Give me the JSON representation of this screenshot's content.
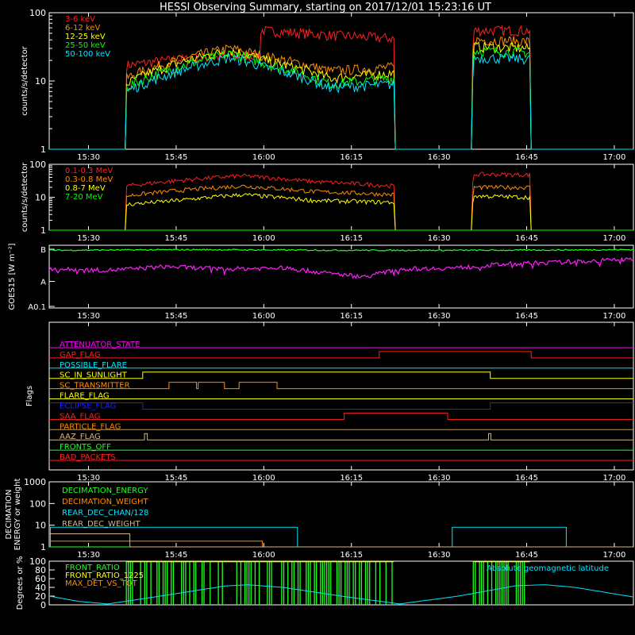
{
  "title": "HESSI Observing Summary, starting on 2017/12/01 15:23:16 UT",
  "time_ticks": [
    "15:30",
    "15:45",
    "16:00",
    "16:15",
    "16:30",
    "16:45",
    "17:00"
  ],
  "time_tick_minutes": [
    6.73,
    21.73,
    36.73,
    51.73,
    66.73,
    81.73,
    96.73
  ],
  "chart_data": [
    {
      "type": "line",
      "panel": "lightcurves-low",
      "ylabel": "counts/s/detector",
      "yscale": "log",
      "ylim": [
        1,
        100
      ],
      "yticks": [
        "1",
        "10",
        "100"
      ],
      "x_unit": "minutes after 15:23:16 UT",
      "xlim": [
        0,
        100
      ],
      "series": [
        {
          "name": "3-6 keV",
          "color": "#ff2020",
          "x": [
            0,
            13,
            13.2,
            20,
            36,
            36.3,
            48,
            59,
            59.1,
            72.4,
            72.6,
            82.3,
            82.4,
            100
          ],
          "y": [
            1,
            1,
            17,
            20,
            24,
            55,
            47,
            42,
            1,
            1,
            55,
            55,
            1,
            1
          ]
        },
        {
          "name": "6-12 keV",
          "color": "#ff8c00",
          "x": [
            0,
            13,
            13.2,
            20,
            31,
            38,
            48,
            59,
            59.1,
            72.4,
            72.6,
            82.3,
            82.4,
            100
          ],
          "y": [
            1,
            1,
            11,
            18,
            30,
            22,
            14,
            16,
            1,
            1,
            40,
            38,
            1,
            1
          ]
        },
        {
          "name": "12-25 keV",
          "color": "#ffff00",
          "x": [
            0,
            13,
            13.2,
            20,
            31,
            38,
            48,
            59,
            59.1,
            72.4,
            72.6,
            82.3,
            82.4,
            100
          ],
          "y": [
            1,
            1,
            9,
            16,
            28,
            19,
            11,
            13,
            1,
            1,
            32,
            30,
            1,
            1
          ]
        },
        {
          "name": "25-50 keV",
          "color": "#00ff00",
          "x": [
            0,
            13,
            13.2,
            20,
            31,
            38,
            48,
            59,
            59.1,
            72.4,
            72.6,
            82.3,
            82.4,
            100
          ],
          "y": [
            1,
            1,
            8,
            14,
            25,
            17,
            9,
            11,
            1,
            1,
            28,
            26,
            1,
            1
          ]
        },
        {
          "name": "50-100 keV",
          "color": "#00e5ff",
          "x": [
            0,
            13,
            13.2,
            20,
            31,
            38,
            48,
            59,
            59.1,
            72.4,
            72.6,
            82.3,
            82.4,
            100
          ],
          "y": [
            1,
            1,
            7,
            12,
            22,
            15,
            8,
            9,
            1,
            1,
            22,
            21,
            1,
            1
          ]
        }
      ]
    },
    {
      "type": "line",
      "panel": "lightcurves-high",
      "ylabel": "counts/s/detector",
      "yscale": "log",
      "ylim": [
        1,
        100
      ],
      "yticks": [
        "1",
        "10",
        "100"
      ],
      "x_unit": "minutes after 15:23:16 UT",
      "xlim": [
        0,
        100
      ],
      "series": [
        {
          "name": "0.1-0.3 MeV",
          "color": "#ff2020",
          "x": [
            0,
            13,
            13.2,
            22,
            33,
            45,
            59,
            59.1,
            72.4,
            72.6,
            82.3,
            82.4,
            100
          ],
          "y": [
            1,
            1,
            22,
            32,
            45,
            30,
            22,
            1,
            1,
            50,
            48,
            1,
            1
          ]
        },
        {
          "name": "0.3-0.8 MeV",
          "color": "#ff8c00",
          "x": [
            0,
            13,
            13.2,
            22,
            33,
            45,
            59,
            59.1,
            72.4,
            72.6,
            82.3,
            82.4,
            100
          ],
          "y": [
            1,
            1,
            11,
            16,
            22,
            15,
            12,
            1,
            1,
            20,
            20,
            1,
            1
          ]
        },
        {
          "name": "0.8-7 MeV",
          "color": "#ffff00",
          "x": [
            0,
            13,
            13.2,
            22,
            33,
            45,
            59,
            59.1,
            72.4,
            72.6,
            82.3,
            82.4,
            100
          ],
          "y": [
            1,
            1,
            6,
            8,
            12,
            8,
            7,
            1,
            1,
            11,
            10,
            1,
            1
          ]
        },
        {
          "name": "7-20 MeV",
          "color": "#00ff00",
          "x": [
            0,
            100
          ],
          "y": [
            1,
            1
          ]
        }
      ]
    },
    {
      "type": "line",
      "panel": "goes",
      "ylabel": "GOES15 [W m⁻²]",
      "yscale": "log",
      "ylim": [
        0.05,
        1.4
      ],
      "yticks": [
        "A0.1",
        "A",
        "B"
      ],
      "ytick_values": [
        0.1,
        1,
        10
      ],
      "x_unit": "minutes after 15:23:16 UT",
      "xlim": [
        0,
        100
      ],
      "series": [
        {
          "color": "#20ff20",
          "x": [
            0,
            25,
            50,
            75,
            100
          ],
          "y": [
            0.92,
            0.93,
            0.92,
            0.92,
            0.93
          ]
        },
        {
          "color": "#ff20ff",
          "x": [
            0,
            10,
            20,
            30,
            40,
            48,
            54,
            60,
            70,
            78,
            88,
            95,
            100
          ],
          "y": [
            0.62,
            0.6,
            0.66,
            0.62,
            0.64,
            0.55,
            0.5,
            0.62,
            0.64,
            0.7,
            0.73,
            0.76,
            0.78
          ]
        }
      ]
    },
    {
      "type": "line",
      "panel": "flags",
      "ylabel": "Flags",
      "xlim": [
        0,
        100
      ],
      "series": [
        {
          "name": "ATTENUATOR_STATE",
          "color": "#ff00ff",
          "x": [
            0,
            100
          ],
          "y": [
            0,
            0
          ]
        },
        {
          "name": "GAP_FLAG",
          "color": "#ff2020",
          "x": [
            0,
            56.5,
            56.5,
            82.5,
            82.5,
            100
          ],
          "y": [
            0,
            0,
            1,
            1,
            0,
            0
          ]
        },
        {
          "name": "POSSIBLE_FLARE",
          "color": "#00e5ff",
          "x": [
            0,
            100
          ],
          "y": [
            0,
            0
          ]
        },
        {
          "name": "SC_IN_SUNLIGHT",
          "color": "#ffff00",
          "x": [
            0,
            16,
            16,
            75.5,
            75.5,
            100
          ],
          "y": [
            0,
            0,
            1,
            1,
            0,
            0
          ]
        },
        {
          "name": "SC_TRANSMITTER",
          "color": "#ff8c00",
          "x": [
            0,
            20.5,
            20.5,
            25.2,
            25.2,
            25.5,
            25.5,
            30,
            30,
            32.5,
            32.5,
            39,
            39,
            100
          ],
          "y": [
            0,
            0,
            1,
            1,
            0,
            0,
            1,
            1,
            0,
            0,
            1,
            1,
            0,
            0
          ]
        },
        {
          "name": "FLARE_FLAG",
          "color": "#ffff00",
          "x": [
            0,
            100
          ],
          "y": [
            0,
            0
          ]
        },
        {
          "name": "ECLIPSE_FLAG",
          "color": "#2020ff",
          "x": [
            0,
            16,
            16,
            75.5,
            75.5,
            100
          ],
          "y": [
            1,
            1,
            0,
            0,
            1,
            1
          ]
        },
        {
          "name": "SAA_FLAG",
          "color": "#ff2020",
          "x": [
            0,
            50.5,
            50.5,
            68.2,
            68.2,
            100
          ],
          "y": [
            0,
            0,
            1,
            1,
            0,
            0
          ]
        },
        {
          "name": "PARTICLE_FLAG",
          "color": "#ff8c00",
          "x": [
            0,
            100
          ],
          "y": [
            0,
            0
          ]
        },
        {
          "name": "AAZ_FLAG",
          "color": "#d2b48c",
          "x": [
            0,
            16.3,
            16.3,
            16.8,
            16.8,
            75.2,
            75.2,
            75.6,
            75.6,
            100
          ],
          "y": [
            0,
            0,
            1,
            1,
            0,
            0,
            1,
            1,
            0,
            0
          ]
        },
        {
          "name": "FRONTS_OFF",
          "color": "#20ff20",
          "x": [
            0,
            100
          ],
          "y": [
            0,
            0
          ]
        },
        {
          "name": "BAD_PACKETS",
          "color": "#ff2020",
          "x": [
            0,
            100
          ],
          "y": [
            0,
            0
          ]
        }
      ]
    },
    {
      "type": "line",
      "panel": "decimation",
      "ylabel": "DECIMATION ENERGY or weight",
      "yscale": "log",
      "ylim": [
        1,
        1000
      ],
      "yticks": [
        "1",
        "10",
        "100",
        "1000"
      ],
      "xlim": [
        0,
        100
      ],
      "series": [
        {
          "name": "DECIMATION_ENERGY",
          "color": "#20ff20",
          "x": [
            0,
            100
          ],
          "y": [
            1,
            1
          ]
        },
        {
          "name": "DECIMATION_WEIGHT",
          "color": "#ff8c00",
          "x": [
            0,
            36.5,
            36.5,
            100
          ],
          "y": [
            1.85,
            1.85,
            1,
            1
          ]
        },
        {
          "name": "REAR_DEC_CHAN/128",
          "color": "#00e5ff",
          "x": [
            0,
            0.2,
            0.2,
            42.5,
            42.5,
            69,
            69,
            88.5,
            88.5,
            100
          ],
          "y": [
            1,
            1,
            8,
            8,
            1,
            1,
            8,
            8,
            1,
            1
          ]
        },
        {
          "name": "REAR_DEC_WEIGHT",
          "color": "#d2b48c",
          "x": [
            0,
            13.8,
            13.8,
            42.5,
            42.5,
            100
          ],
          "y": [
            4,
            4,
            1,
            1,
            1,
            1
          ]
        }
      ]
    },
    {
      "type": "line",
      "panel": "ratios",
      "ylabel": "Degrees or %",
      "ylim": [
        0,
        100
      ],
      "yticks": [
        "0",
        "20",
        "40",
        "60",
        "80",
        "100"
      ],
      "xlim": [
        0,
        100
      ],
      "series": [
        {
          "name": "FRONT_RATIO",
          "color": "#20ff20"
        },
        {
          "name": "FRONT_RATIO_1225",
          "color": "#ffff00"
        },
        {
          "name": "MAX_DET_VS_TOT",
          "color": "#ff8c00"
        },
        {
          "name": "Absolute geomagnetic latitude",
          "color": "#00e5ff",
          "x": [
            0,
            5,
            10,
            20,
            30,
            34,
            40,
            50,
            60,
            70,
            80,
            85,
            90,
            100
          ],
          "y": [
            20,
            8,
            2,
            22,
            43,
            46,
            40,
            20,
            2,
            20,
            44,
            46,
            40,
            18
          ]
        }
      ]
    }
  ]
}
